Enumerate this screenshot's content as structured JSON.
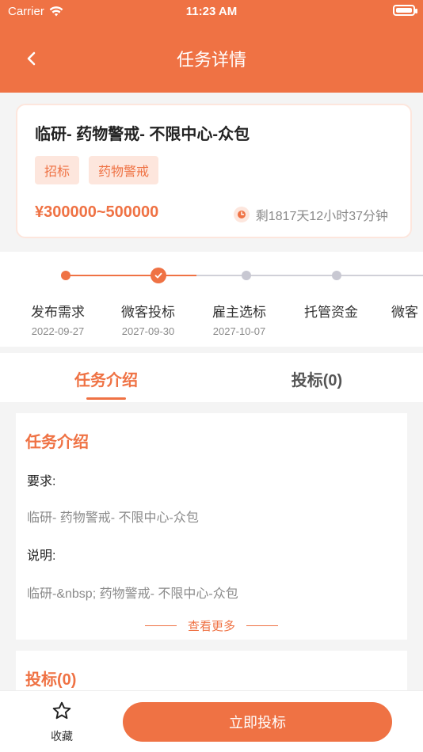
{
  "status_bar": {
    "carrier": "Carrier",
    "time": "11:23 AM"
  },
  "nav": {
    "title": "任务详情"
  },
  "task": {
    "title": "临研-  药物警戒- 不限中心-众包",
    "tags": [
      "招标",
      "药物警戒"
    ],
    "price": "¥300000~500000",
    "remaining": "剩1817天12小时37分钟"
  },
  "progress": {
    "steps": [
      {
        "label": "发布需求",
        "date": "2022-09-27"
      },
      {
        "label": "微客投标",
        "date": "2027-09-30"
      },
      {
        "label": "雇主选标",
        "date": "2027-10-07"
      },
      {
        "label": "托管资金",
        "date": ""
      },
      {
        "label": "微客",
        "date": ""
      }
    ]
  },
  "tabs": [
    {
      "label": "任务介绍"
    },
    {
      "label": "投标(0)"
    }
  ],
  "intro": {
    "title": "任务介绍",
    "requirement_label": "要求:",
    "requirement_text": "临研-  药物警戒- 不限中心-众包",
    "explanation_label": "说明:",
    "explanation_text": "临研-&nbsp; 药物警戒- 不限中心-众包",
    "more_label": "查看更多"
  },
  "bids": {
    "title": "投标(0)"
  },
  "bottom": {
    "favorite_label": "收藏",
    "bid_button": "立即投标"
  },
  "colors": {
    "accent": "#EF7244",
    "accent_light": "#FDE6DD"
  }
}
